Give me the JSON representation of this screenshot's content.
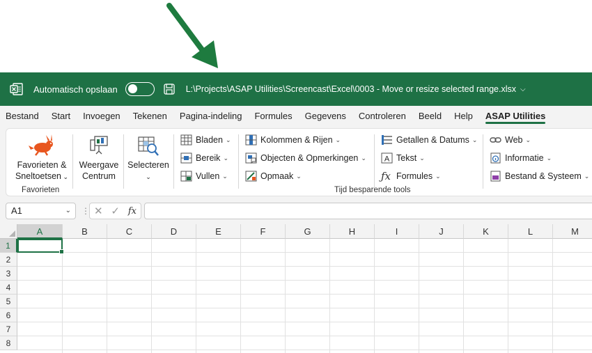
{
  "titlebar": {
    "autosave_label": "Automatisch opslaan",
    "file_path": "L:\\Projects\\ASAP Utilities\\Screencast\\Excel\\0003 - Move or resize selected range.xlsx",
    "accent_color": "#1e7145"
  },
  "menu": {
    "tabs": [
      "Bestand",
      "Start",
      "Invoegen",
      "Tekenen",
      "Pagina-indeling",
      "Formules",
      "Gegevens",
      "Controleren",
      "Beeld",
      "Help",
      "ASAP Utilities"
    ],
    "active": "ASAP Utilities"
  },
  "ribbon": {
    "favorieten": {
      "line1": "Favorieten &",
      "line2": "Sneltoetsen",
      "group": "Favorieten"
    },
    "weergave": {
      "line1": "Weergave",
      "line2": "Centrum"
    },
    "selecteren": {
      "label": "Selecteren"
    },
    "col1": [
      "Bladen",
      "Bereik",
      "Vullen"
    ],
    "col2": [
      "Kolommen & Rijen",
      "Objecten & Opmerkingen",
      "Opmaak"
    ],
    "col3": [
      "Getallen & Datums",
      "Tekst",
      "Formules"
    ],
    "col4": [
      "Web",
      "Informatie",
      "Bestand & Systeem"
    ],
    "group_tools": "Tijd besparende tools"
  },
  "formula_bar": {
    "name_box": "A1",
    "fx": "fx",
    "formula": ""
  },
  "grid": {
    "columns": [
      "A",
      "B",
      "C",
      "D",
      "E",
      "F",
      "G",
      "H",
      "I",
      "J",
      "K",
      "L",
      "M"
    ],
    "rows": [
      "1",
      "2",
      "3",
      "4",
      "5",
      "6",
      "7",
      "8"
    ],
    "active_cell": "A1"
  }
}
